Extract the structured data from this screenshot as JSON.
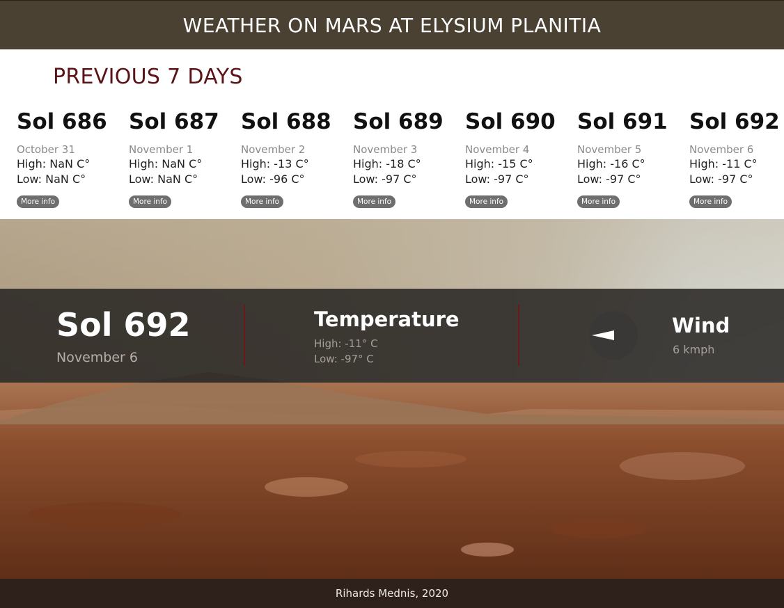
{
  "header": {
    "title": "WEATHER ON MARS AT ELYSIUM PLANITIA"
  },
  "previous": {
    "title": "PREVIOUS 7 DAYS",
    "more_label": "More info",
    "days": [
      {
        "sol": "Sol 686",
        "date": "October 31",
        "high": "High: NaN C°",
        "low": "Low: NaN C°"
      },
      {
        "sol": "Sol 687",
        "date": "November 1",
        "high": "High: NaN C°",
        "low": "Low: NaN C°"
      },
      {
        "sol": "Sol 688",
        "date": "November 2",
        "high": "High: -13 C°",
        "low": "Low: -96 C°"
      },
      {
        "sol": "Sol 689",
        "date": "November 3",
        "high": "High: -18 C°",
        "low": "Low: -97 C°"
      },
      {
        "sol": "Sol 690",
        "date": "November 4",
        "high": "High: -15 C°",
        "low": "Low: -97 C°"
      },
      {
        "sol": "Sol 691",
        "date": "November 5",
        "high": "High: -16 C°",
        "low": "Low: -97 C°"
      },
      {
        "sol": "Sol 692",
        "date": "November 6",
        "high": "High: -11 C°",
        "low": "Low: -97 C°"
      }
    ]
  },
  "current": {
    "sol": "Sol 692",
    "date": "November 6",
    "temperature_title": "Temperature",
    "high": "High: -11° C",
    "low": "Low: -97° C",
    "wind_title": "Wind",
    "wind_speed": "6 kmph",
    "wind_icon": "wind-direction-arrow-icon"
  },
  "footer": {
    "credit": "Rihards Mednis, 2020"
  },
  "colors": {
    "header_bg": "#4b4132",
    "prev_title": "#5a1418",
    "info_bar": "#262422",
    "divider": "#6b1a1a",
    "footer_bg": "#2e201a"
  }
}
